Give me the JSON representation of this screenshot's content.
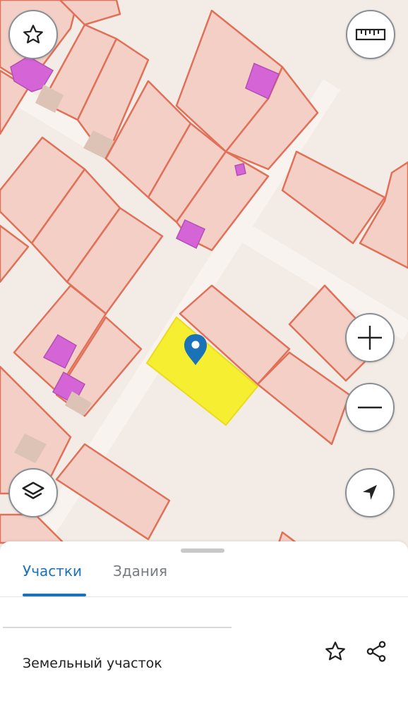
{
  "map": {
    "background_color": "#f3ece6",
    "parcel_fill": "#f3cfc5",
    "parcel_stroke": "#e07058",
    "building_color": "#d565d6",
    "selected_parcel_color": "#f6ee30",
    "marker_color": "#1a73b8",
    "marker": "location-pin-icon"
  },
  "controls": {
    "favorite": "star-icon",
    "ruler": "ruler-icon",
    "zoom_in": "plus-icon",
    "zoom_out": "minus-icon",
    "layers": "layers-icon",
    "location": "navigation-arrow-icon"
  },
  "sheet": {
    "tabs": [
      {
        "label": "Участки",
        "active": true
      },
      {
        "label": "Здания",
        "active": false
      }
    ],
    "item": {
      "title": "Земельный участок",
      "actions": [
        "star-icon",
        "share-icon"
      ]
    }
  },
  "colors": {
    "accent": "#1a73b8"
  }
}
